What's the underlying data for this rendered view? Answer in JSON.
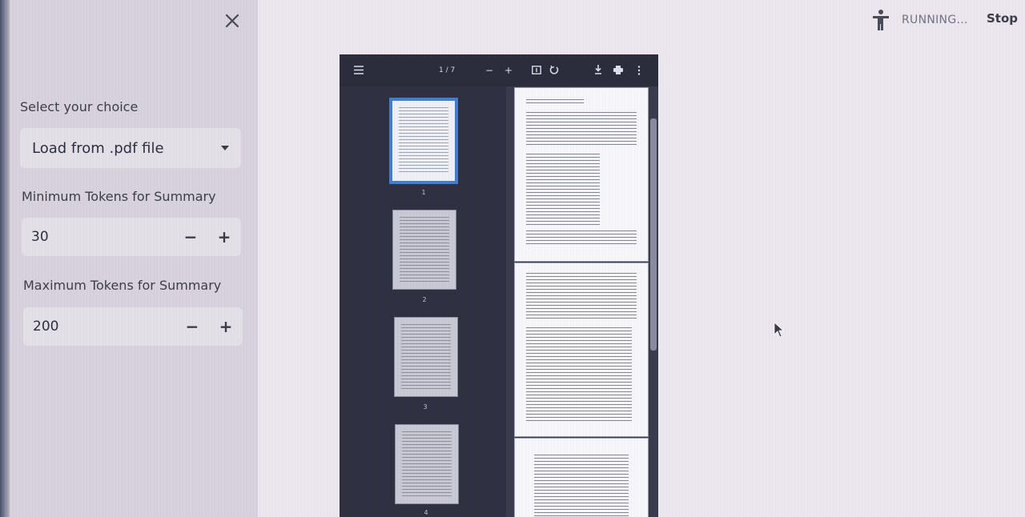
{
  "sidebar": {
    "close_icon": "close-icon",
    "select_label": "Select your choice",
    "select_value": "Load from .pdf file",
    "min_tokens": {
      "label": "Minimum Tokens for Summary",
      "value": "30",
      "minus": "−",
      "plus": "+"
    },
    "max_tokens": {
      "label": "Maximum Tokens for Summary",
      "value": "200",
      "minus": "−",
      "plus": "+"
    }
  },
  "header": {
    "status_icon": "running-person-icon",
    "status_text": "RUNNING...",
    "stop_label": "Stop"
  },
  "pdf_viewer": {
    "toolbar": {
      "menu_icon": "sidebar-toggle-icon",
      "page_indicator": "1 / 7",
      "zoom_out": "−",
      "zoom_in": "+",
      "download_icon": "download-icon",
      "print_icon": "print-icon",
      "more_icon": "more-vertical-icon"
    },
    "thumbnails": [
      "1",
      "2",
      "3",
      "4"
    ]
  },
  "colors": {
    "sidebar_bg": "#d7d2dd",
    "main_bg": "#ece6ee",
    "viewer_bg": "#3a3c4e",
    "thumb_active_border": "#3f7fd6"
  }
}
